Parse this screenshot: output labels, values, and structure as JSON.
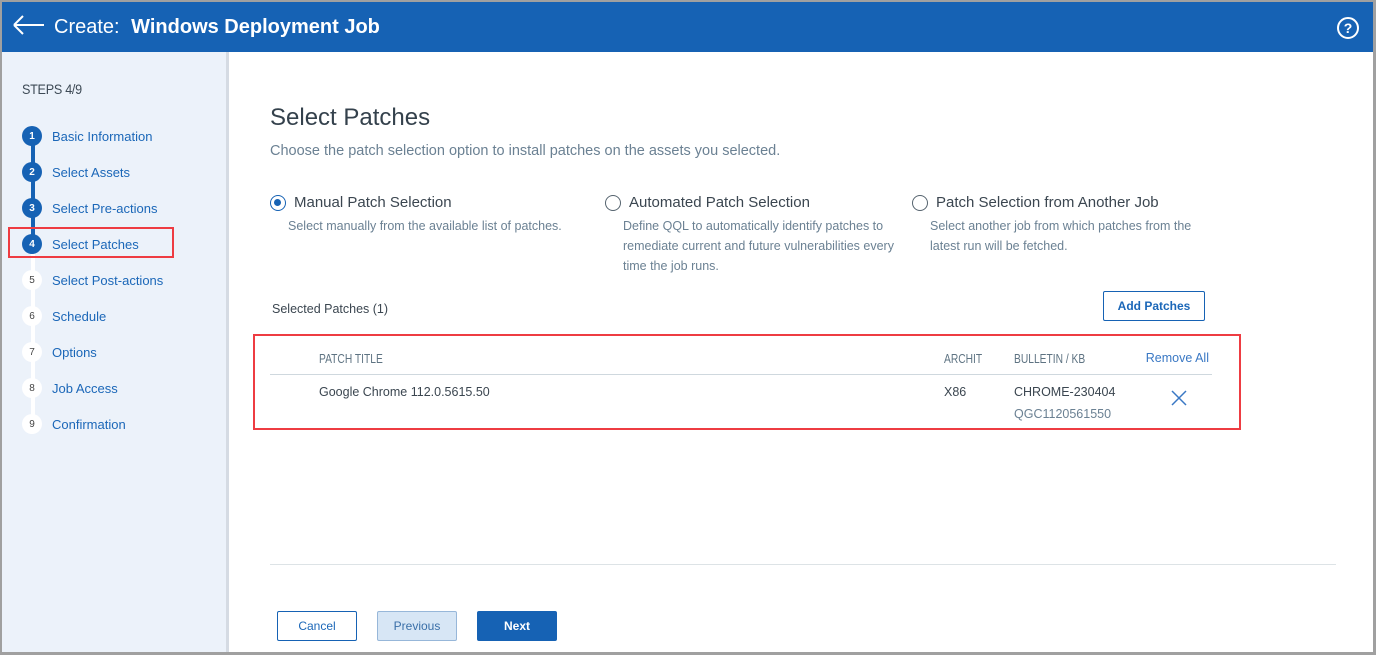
{
  "header": {
    "title_prefix": "Create:",
    "title": "Windows Deployment Job",
    "back_icon": "arrow-left-icon",
    "help_icon": "help-circle-icon",
    "help_glyph": "?"
  },
  "sidebar": {
    "steps_heading": "STEPS 4/9",
    "current_step": 4,
    "total_steps": 9,
    "steps": [
      {
        "num": "1",
        "label": "Basic Information",
        "status": "done"
      },
      {
        "num": "2",
        "label": "Select Assets",
        "status": "done"
      },
      {
        "num": "3",
        "label": "Select Pre-actions",
        "status": "done"
      },
      {
        "num": "4",
        "label": "Select Patches",
        "status": "active"
      },
      {
        "num": "5",
        "label": "Select Post-actions",
        "status": "todo"
      },
      {
        "num": "6",
        "label": "Schedule",
        "status": "todo"
      },
      {
        "num": "7",
        "label": "Options",
        "status": "todo"
      },
      {
        "num": "8",
        "label": "Job Access",
        "status": "todo"
      },
      {
        "num": "9",
        "label": "Confirmation",
        "status": "todo"
      }
    ]
  },
  "main": {
    "title": "Select Patches",
    "subtitle": "Choose the patch selection option to install patches on the assets you selected.",
    "options": [
      {
        "label": "Manual Patch Selection",
        "description": "Select manually from the available list of patches.",
        "checked": true
      },
      {
        "label": "Automated Patch Selection",
        "description": "Define QQL to automatically identify patches to remediate current and future vulnerabilities every time the job runs.",
        "checked": false
      },
      {
        "label": "Patch Selection from Another Job",
        "description": "Select another job from which patches from the latest run will be fetched.",
        "checked": false
      }
    ],
    "selected_count_label": "Selected Patches (1)",
    "add_patches_label": "Add Patches",
    "table": {
      "columns": [
        "PATCH TITLE",
        "ARCHIT",
        "BULLETIN / KB"
      ],
      "remove_all_label": "Remove All",
      "rows": [
        {
          "title": "Google Chrome 112.0.5615.50",
          "architecture": "X86",
          "bulletin": "CHROME-230404",
          "kb": "QGC1120561550",
          "remove_icon": "close-x-icon"
        }
      ]
    }
  },
  "footer": {
    "cancel_label": "Cancel",
    "previous_label": "Previous",
    "next_label": "Next"
  },
  "colors": {
    "brand": "#1662b4",
    "highlight": "#ee3c42",
    "sidebar_bg": "#ecf2fa"
  }
}
